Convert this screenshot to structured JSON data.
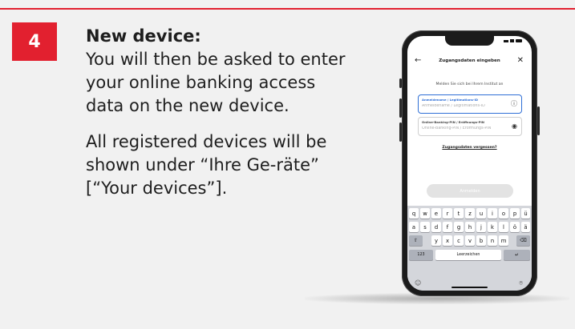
{
  "step": {
    "number": "4",
    "title": "New device:",
    "paragraph1": "You will then be asked to enter your online banking access data on the new device.",
    "paragraph2": "All registered devices will be shown under “Ihre Ge-räte” [“Your devices”]."
  },
  "colors": {
    "accent": "#e2202f",
    "field_active": "#2f6fd6",
    "background": "#f1f1f1"
  },
  "phone": {
    "nav": {
      "title": "Zugangsdaten eingeben",
      "back_icon": "arrow-left-icon",
      "close_icon": "close-icon"
    },
    "subtitle": "Melden Sie sich bei Ihrem Institut an",
    "fields": [
      {
        "label": "Anmeldename / Legitimations-ID",
        "placeholder": "Anmeldename / Legitimations-ID",
        "icon": "info-icon"
      },
      {
        "label": "Online-Banking-PIN / Eröffnungs-PIN",
        "placeholder": "Online-Banking-PIN / Eröffnungs-PIN",
        "icon": "eye-icon"
      }
    ],
    "forgot_link": "Zugangsdaten vergessen?",
    "login_button": "Anmelden",
    "keyboard": {
      "row1": [
        "q",
        "w",
        "e",
        "r",
        "t",
        "z",
        "u",
        "i",
        "o",
        "p",
        "ü"
      ],
      "row2": [
        "a",
        "s",
        "d",
        "f",
        "g",
        "h",
        "j",
        "k",
        "l",
        "ö",
        "ä"
      ],
      "row3": [
        "y",
        "x",
        "c",
        "v",
        "b",
        "n",
        "m"
      ],
      "numbers_key": "123",
      "space_key": "Leerzeichen",
      "shift_icon": "shift-icon",
      "delete_icon": "backspace-icon",
      "return_icon": "return-icon",
      "emoji_icon": "emoji-icon",
      "mic_icon": "microphone-icon"
    }
  }
}
